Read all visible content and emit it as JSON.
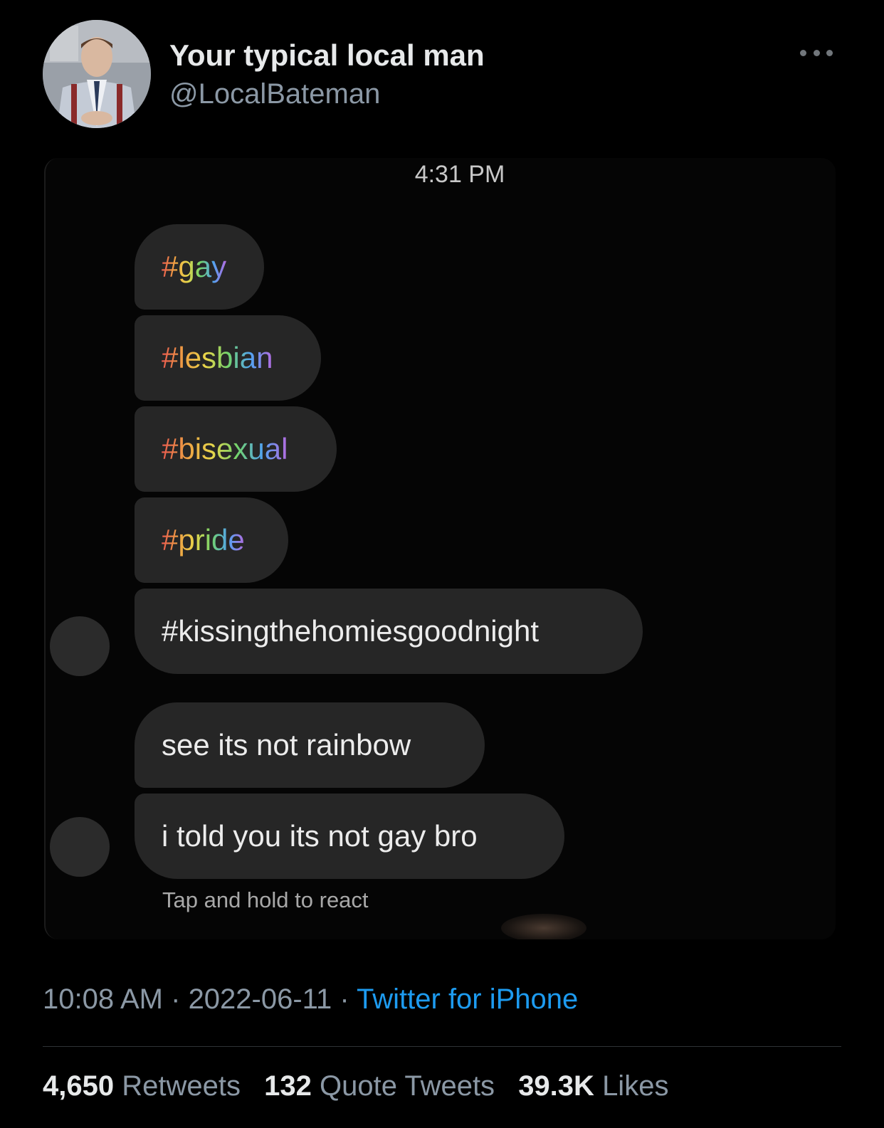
{
  "author": {
    "display_name": "Your typical local man",
    "handle": "@LocalBateman",
    "avatar_icon": "avatar-photo"
  },
  "more_icon": "more-horizontal-icon",
  "chat": {
    "time": "4:31 PM",
    "messages": [
      {
        "text": "#gay",
        "style": "rainbow"
      },
      {
        "text": "#lesbian",
        "style": "rainbow"
      },
      {
        "text": "#bisexual",
        "style": "rainbow"
      },
      {
        "text": "#pride",
        "style": "rainbow"
      },
      {
        "text": "#kissingthehomiesgoodnight",
        "style": "plain"
      },
      {
        "text": "see its not rainbow",
        "style": "plain"
      },
      {
        "text": "i told you its not gay bro",
        "style": "plain"
      }
    ],
    "react_hint": "Tap and hold to react"
  },
  "tweet_meta": {
    "time": "10:08 AM",
    "separator": " · ",
    "date": "2022-06-11",
    "source": "Twitter for iPhone"
  },
  "stats": {
    "retweets_count": "4,650",
    "retweets_label": "Retweets",
    "quotes_count": "132",
    "quotes_label": "Quote Tweets",
    "likes_count": "39.3K",
    "likes_label": "Likes"
  },
  "colors": {
    "background": "#000000",
    "bubble": "#262626",
    "link": "#1d9bf0",
    "secondary_text": "#8b98a5"
  }
}
